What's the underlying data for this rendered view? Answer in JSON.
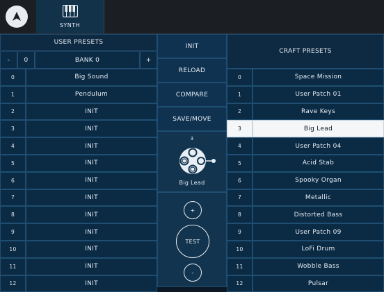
{
  "topbar": {
    "synth_tab_label": "SYNTH"
  },
  "user_presets": {
    "title": "USER PRESETS",
    "bank_minus": "-",
    "bank_number": "0",
    "bank_label": "BANK 0",
    "bank_plus": "+",
    "rows": [
      {
        "n": "0",
        "name": "Big Sound"
      },
      {
        "n": "1",
        "name": "Pendulum"
      },
      {
        "n": "2",
        "name": "INIT"
      },
      {
        "n": "3",
        "name": "INIT"
      },
      {
        "n": "4",
        "name": "INIT"
      },
      {
        "n": "5",
        "name": "INIT"
      },
      {
        "n": "6",
        "name": "INIT"
      },
      {
        "n": "7",
        "name": "INIT"
      },
      {
        "n": "8",
        "name": "INIT"
      },
      {
        "n": "9",
        "name": "INIT"
      },
      {
        "n": "10",
        "name": "INIT"
      },
      {
        "n": "11",
        "name": "INIT"
      },
      {
        "n": "12",
        "name": "INIT"
      }
    ]
  },
  "middle": {
    "init": "INIT",
    "reload": "RELOAD",
    "compare": "COMPARE",
    "save_move": "SAVE/MOVE",
    "preview_number": "3",
    "preview_name": "Big Lead",
    "plus": "+",
    "test": "TEST",
    "minus": "-"
  },
  "craft_presets": {
    "title": "CRAFT PRESETS",
    "selected_index": 3,
    "rows": [
      {
        "n": "0",
        "name": "Space Mission"
      },
      {
        "n": "1",
        "name": "User Patch 01"
      },
      {
        "n": "2",
        "name": "Rave Keys"
      },
      {
        "n": "3",
        "name": "Big Lead"
      },
      {
        "n": "4",
        "name": "User Patch 04"
      },
      {
        "n": "5",
        "name": "Acid Stab"
      },
      {
        "n": "6",
        "name": "Spooky Organ"
      },
      {
        "n": "7",
        "name": "Metallic"
      },
      {
        "n": "8",
        "name": "Distorted Bass"
      },
      {
        "n": "9",
        "name": "User Patch 09"
      },
      {
        "n": "10",
        "name": "LoFi Drum"
      },
      {
        "n": "11",
        "name": "Wobble Bass"
      },
      {
        "n": "12",
        "name": "Pulsar"
      }
    ]
  },
  "icons": {
    "logo": "app-logo-icon",
    "synth": "piano-keys-icon",
    "preview": "node-diagram-icon"
  },
  "colors": {
    "background": "#0c1824",
    "cell": "#0b2a44",
    "cell_border": "#1f4e72",
    "selected": "#f4f6f8"
  }
}
